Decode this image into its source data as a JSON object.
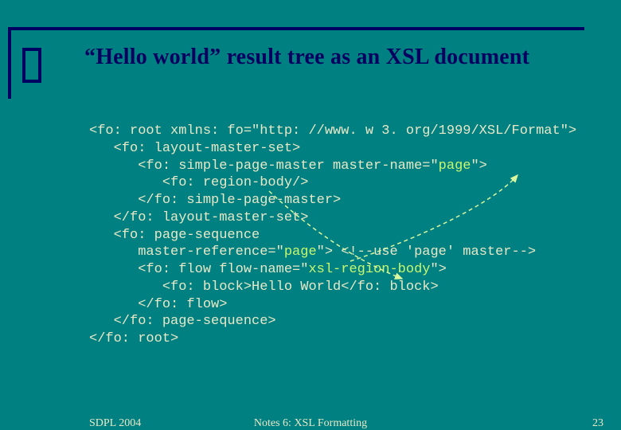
{
  "slide": {
    "title": "“Hello world” result tree as an XSL document"
  },
  "code": {
    "lines": [
      {
        "indent": 0,
        "pre": "<fo: root xmlns: fo=\"http: //www. w 3. org/1999/XSL/Format\">",
        "hl": "",
        "post": ""
      },
      {
        "indent": 1,
        "pre": "<fo: layout-master-set>",
        "hl": "",
        "post": ""
      },
      {
        "indent": 2,
        "pre": "<fo: simple-page-master master-name=\"",
        "hl": "page",
        "post": "\">"
      },
      {
        "indent": 3,
        "pre": "<fo: region-body/>",
        "hl": "",
        "post": ""
      },
      {
        "indent": 2,
        "pre": "</fo: simple-page-master>",
        "hl": "",
        "post": ""
      },
      {
        "indent": 1,
        "pre": "</fo: layout-master-set>",
        "hl": "",
        "post": ""
      },
      {
        "indent": 1,
        "pre": "<fo: page-sequence",
        "hl": "",
        "post": ""
      },
      {
        "indent": 2,
        "pre": "master-reference=\"",
        "hl": "page",
        "post": "\"> <!--use 'page' master-->"
      },
      {
        "indent": 2,
        "pre": "<fo: flow flow-name=\"",
        "hl": "xsl-region-body",
        "post": "\">"
      },
      {
        "indent": 3,
        "pre": "<fo: block>Hello World</fo: block>",
        "hl": "",
        "post": ""
      },
      {
        "indent": 2,
        "pre": "</fo: flow>",
        "hl": "",
        "post": ""
      },
      {
        "indent": 1,
        "pre": "</fo: page-sequence>",
        "hl": "",
        "post": ""
      },
      {
        "indent": 0,
        "pre": "</fo: root>",
        "hl": "",
        "post": ""
      }
    ]
  },
  "footer": {
    "left": "SDPL 2004",
    "center": "Notes 6: XSL Formatting",
    "right": "23"
  }
}
